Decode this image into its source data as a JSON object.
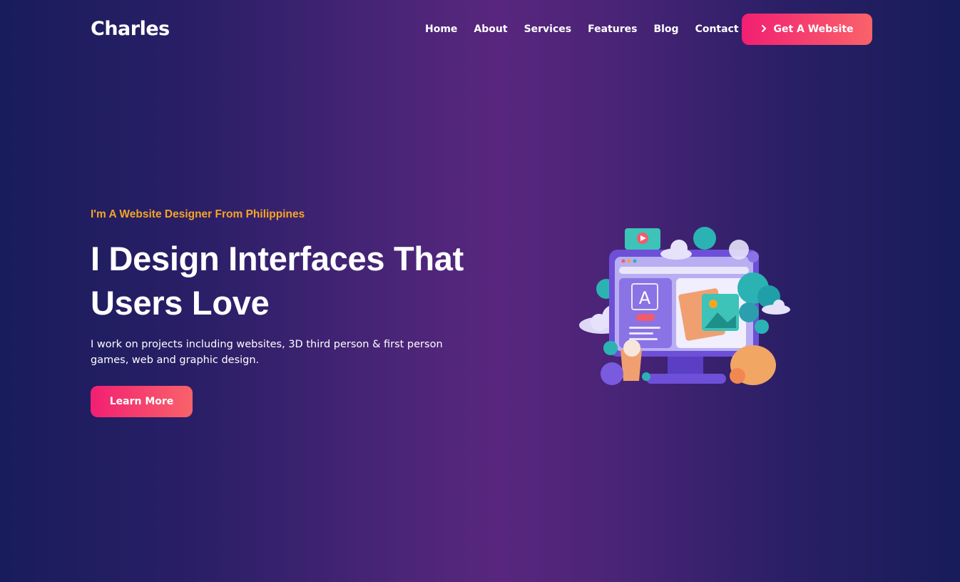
{
  "header": {
    "logo": "Charles",
    "nav": [
      "Home",
      "About",
      "Services",
      "Features",
      "Blog",
      "Contact"
    ],
    "cta_label": "Get A Website",
    "cta_icon": "chevron-right-icon"
  },
  "hero": {
    "tagline": "I'm A Website Designer From Philippines",
    "headline_line1": "I Design Interfaces That",
    "headline_line2": "Users Love",
    "description": "I work on projects including websites, 3D third person & first person games, web and graphic design.",
    "button_label": "Learn More"
  },
  "colors": {
    "accent_start": "#f21f72",
    "accent_end": "#f9636a",
    "tagline": "#f5a524",
    "bg_dark": "#181c5c",
    "bg_mid": "#58267e"
  }
}
